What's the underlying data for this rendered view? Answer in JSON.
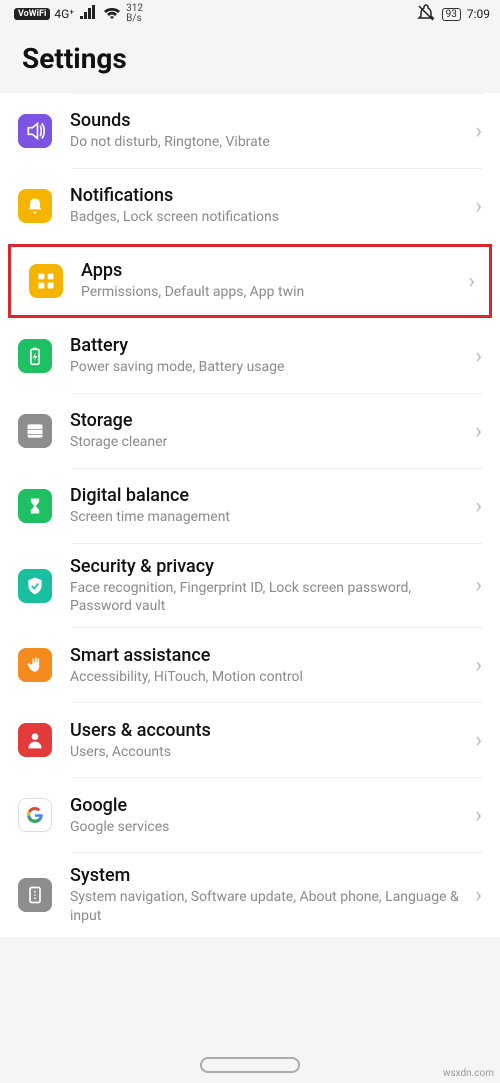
{
  "status": {
    "vowifi": "VoWiFi",
    "network": "4G⁺",
    "rate_top": "312",
    "rate_bottom": "B/s",
    "battery": "93",
    "time": "7:09"
  },
  "header": {
    "title": "Settings"
  },
  "items": [
    {
      "title": "Sounds",
      "sub": "Do not disturb, Ringtone, Vibrate",
      "icon": "sound",
      "color": "#7c54e3",
      "highlight": false,
      "name": "sounds"
    },
    {
      "title": "Notifications",
      "sub": "Badges, Lock screen notifications",
      "icon": "bell",
      "color": "#f5b400",
      "highlight": false,
      "name": "notifications"
    },
    {
      "title": "Apps",
      "sub": "Permissions, Default apps, App twin",
      "icon": "grid",
      "color": "#f5b400",
      "highlight": true,
      "name": "apps"
    },
    {
      "title": "Battery",
      "sub": "Power saving mode, Battery usage",
      "icon": "battery",
      "color": "#1fbf63",
      "highlight": false,
      "name": "battery"
    },
    {
      "title": "Storage",
      "sub": "Storage cleaner",
      "icon": "storage",
      "color": "#8d8d8d",
      "highlight": false,
      "name": "storage"
    },
    {
      "title": "Digital balance",
      "sub": "Screen time management",
      "icon": "hourglass",
      "color": "#1fbf63",
      "highlight": false,
      "name": "digital-balance"
    },
    {
      "title": "Security & privacy",
      "sub": "Face recognition, Fingerprint ID, Lock screen password, Password vault",
      "icon": "shield",
      "color": "#1abfa0",
      "highlight": false,
      "name": "security-privacy"
    },
    {
      "title": "Smart assistance",
      "sub": "Accessibility, HiTouch, Motion control",
      "icon": "hand",
      "color": "#f58a1f",
      "highlight": false,
      "name": "smart-assistance"
    },
    {
      "title": "Users & accounts",
      "sub": "Users, Accounts",
      "icon": "user",
      "color": "#e33b3b",
      "highlight": false,
      "name": "users-accounts"
    },
    {
      "title": "Google",
      "sub": "Google services",
      "icon": "google",
      "color": "#ffffff",
      "highlight": false,
      "name": "google"
    },
    {
      "title": "System",
      "sub": "System navigation, Software update, About phone, Language & input",
      "icon": "system",
      "color": "#8d8d8d",
      "highlight": false,
      "name": "system"
    }
  ],
  "watermark": "wsxdn.com"
}
